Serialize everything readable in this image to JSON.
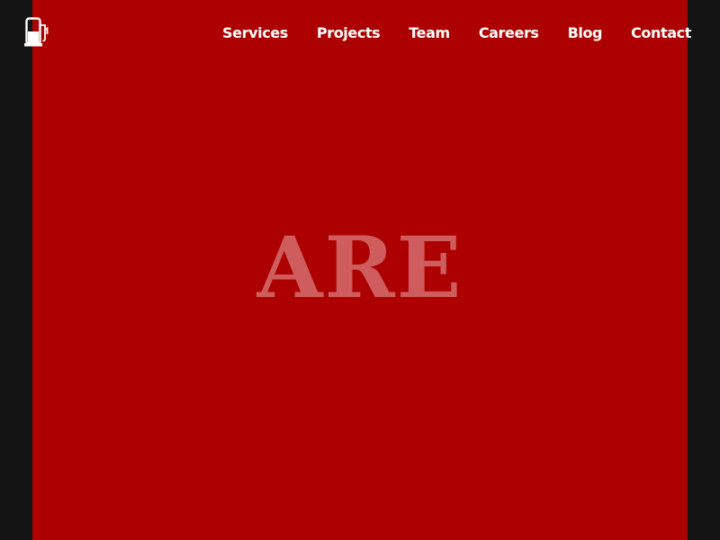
{
  "brand": {
    "logo_icon": "fuel-pump-icon"
  },
  "nav": {
    "items": [
      {
        "label": "Services"
      },
      {
        "label": "Projects"
      },
      {
        "label": "Team"
      },
      {
        "label": "Careers"
      },
      {
        "label": "Blog"
      },
      {
        "label": "Contact"
      }
    ]
  },
  "hero": {
    "word": "ARE"
  },
  "colors": {
    "background": "#141414",
    "accent": "#ad0000",
    "hero_text": "#cf5d5d",
    "nav_text": "#ffffff"
  }
}
